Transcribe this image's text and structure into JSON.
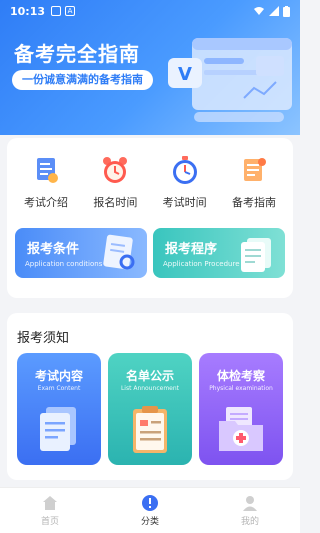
{
  "status_bar": {
    "time": "10:13",
    "icon_label": "A"
  },
  "banner": {
    "title": "备考完全指南",
    "subtitle": "一份诚意满满的备考指南",
    "art_badge": "V"
  },
  "quick_links": [
    {
      "label": "考试介绍",
      "icon": "document-icon"
    },
    {
      "label": "报名时间",
      "icon": "alarm-clock-icon"
    },
    {
      "label": "考试时间",
      "icon": "stopwatch-icon"
    },
    {
      "label": "备考指南",
      "icon": "scroll-icon"
    }
  ],
  "entries": [
    {
      "title": "报考条件",
      "subtitle": "Application conditions"
    },
    {
      "title": "报考程序",
      "subtitle": "Application Procedure"
    }
  ],
  "notice": {
    "heading": "报考须知",
    "tiles": [
      {
        "title": "考试内容",
        "subtitle": "Exam Content"
      },
      {
        "title": "名单公示",
        "subtitle": "List Announcement"
      },
      {
        "title": "体检考察",
        "subtitle": "Physical examination"
      }
    ]
  },
  "nav": {
    "items": [
      {
        "label": "首页",
        "icon": "home-icon"
      },
      {
        "label": "分类",
        "icon": "category-icon",
        "active": true
      },
      {
        "label": "我的",
        "icon": "user-icon"
      }
    ]
  }
}
